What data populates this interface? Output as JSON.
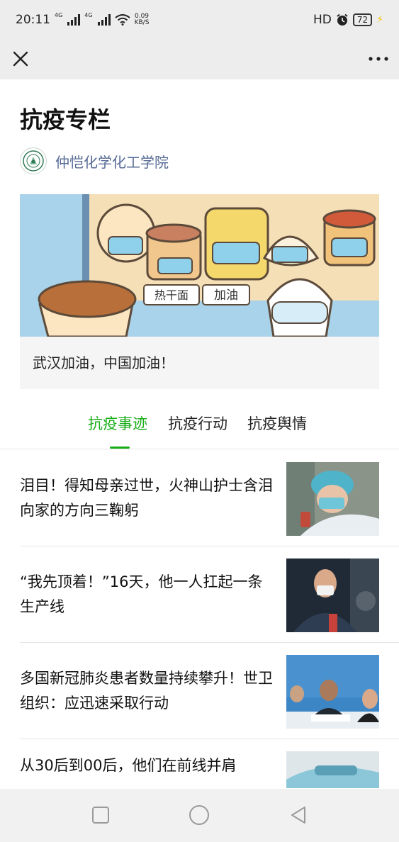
{
  "status_bar": {
    "time": "20:11",
    "net1": "4G",
    "net2": "4G",
    "speed_value": "0.09",
    "speed_unit": "KB/S",
    "hd": "HD",
    "battery": "72"
  },
  "article_page": {
    "title": "抗疫专栏",
    "author": "仲恺化学化工学院",
    "banner": {
      "sign_left": "热干面",
      "sign_right": "加油",
      "caption": "武汉加油，中国加油！"
    },
    "tabs": [
      "抗疫事迹",
      "抗疫行动",
      "抗疫舆情"
    ],
    "active_tab": 0,
    "articles": [
      {
        "title": "泪目！得知母亲过世，火神山护士含泪向家的方向三鞠躬"
      },
      {
        "title": "“我先顶着！”16天，他一人扛起一条生产线"
      },
      {
        "title": "多国新冠肺炎患者数量持续攀升！世卫组织：应迅速采取行动"
      },
      {
        "title": "从30后到00后，他们在前线并肩"
      }
    ]
  },
  "colors": {
    "accent": "#1aad19",
    "author_link": "#576b95",
    "bar_bg": "#ededed"
  }
}
